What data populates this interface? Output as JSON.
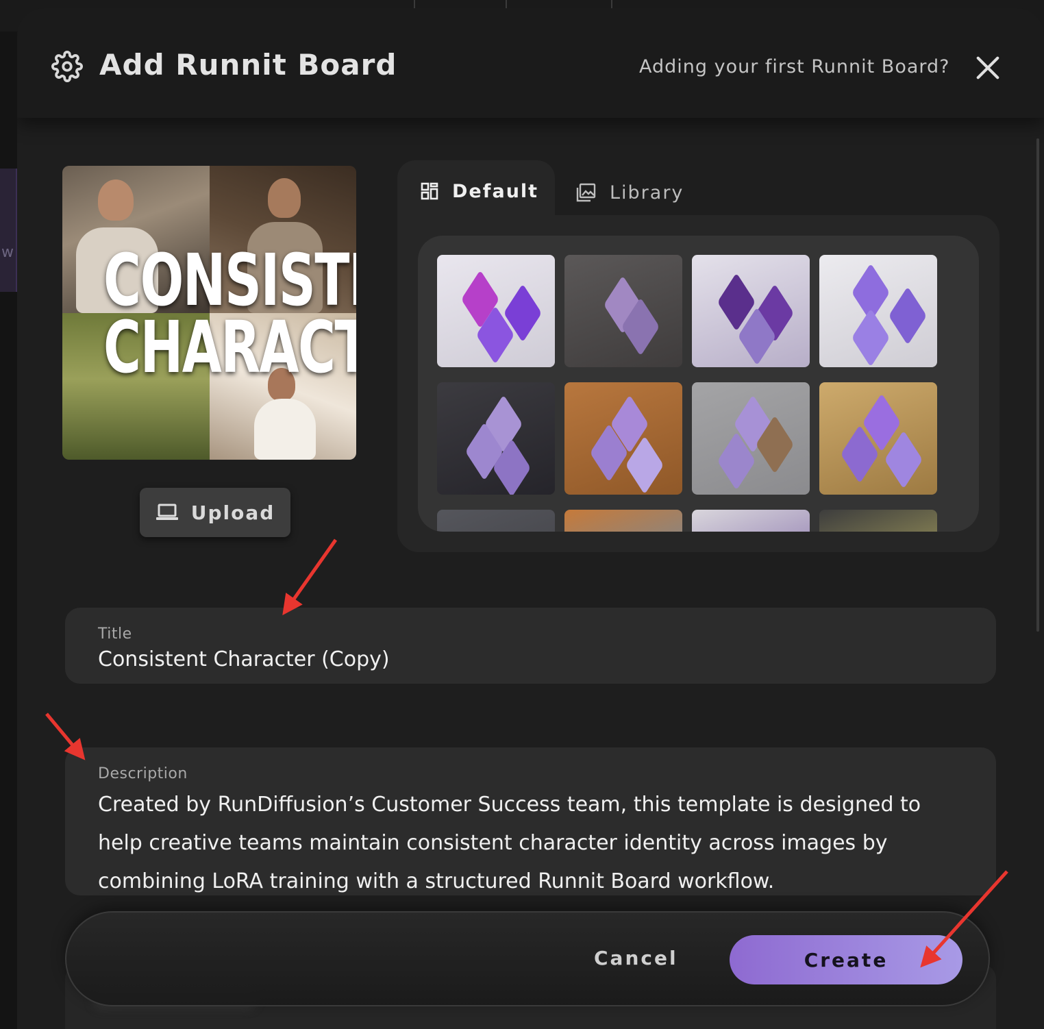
{
  "modal": {
    "title": "Add Runnit Board",
    "help_link": "Adding your first Runnit Board?"
  },
  "background": {
    "sidebar_partial_text": "w"
  },
  "preview": {
    "overlay_line1": "CONSISTENT",
    "overlay_line2": "CHARACTER"
  },
  "upload": {
    "label": "Upload"
  },
  "tabs": [
    {
      "label": "Default",
      "active": true
    },
    {
      "label": "Library",
      "active": false
    }
  ],
  "thumbnails_visible": 12,
  "fields": {
    "title": {
      "label": "Title",
      "value": "Consistent Character (Copy)"
    },
    "description": {
      "label": "Description",
      "value": "Created by RunDiffusion’s Customer Success team, this template is designed to help creative teams maintain consistent character identity across images by combining LoRA training with a structured Runnit Board workflow."
    }
  },
  "footer": {
    "cancel_label": "Cancel",
    "create_label": "Create"
  },
  "colors": {
    "accent_start": "#8e6ad1",
    "accent_end": "#a89ae6",
    "annotation_arrow": "#e8362f"
  }
}
